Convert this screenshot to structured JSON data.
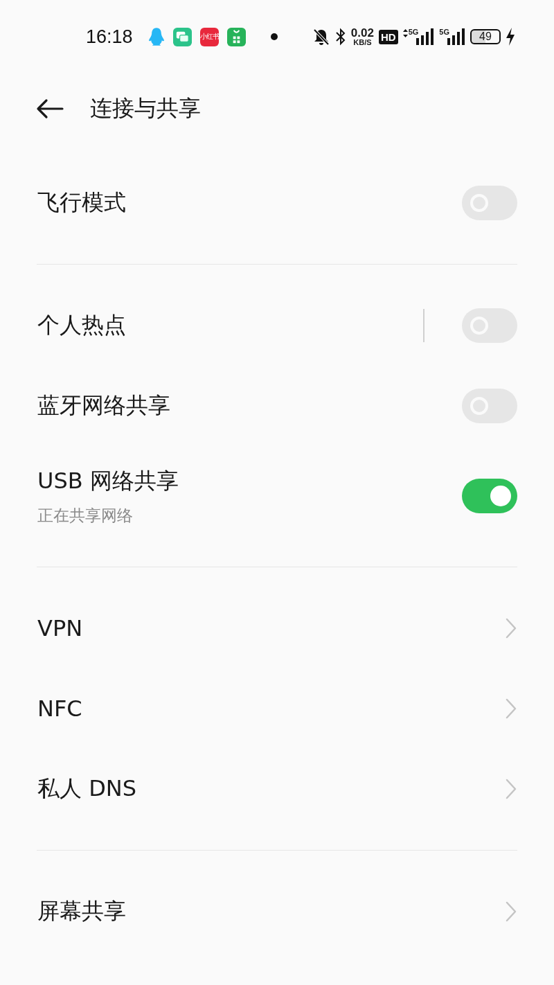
{
  "status_bar": {
    "time": "16:18",
    "apps": [
      {
        "kind": "penguin"
      },
      {
        "kind": "chat"
      },
      {
        "kind": "label",
        "label": "小红书"
      },
      {
        "kind": "bag"
      }
    ],
    "speed": "0.02",
    "speed_unit": "KB/S",
    "hd": "HD",
    "signals": [
      {
        "label": "5G",
        "arrows": true
      },
      {
        "label": "5G",
        "arrows": false
      }
    ],
    "battery": "49",
    "charging": true
  },
  "header": {
    "title": "连接与共享"
  },
  "groups": [
    {
      "rows": [
        {
          "kind": "toggle",
          "label": "飞行模式",
          "on": false
        }
      ]
    },
    {
      "rows": [
        {
          "kind": "toggle_split",
          "label": "个人热点",
          "on": false
        },
        {
          "kind": "toggle",
          "label": "蓝牙网络共享",
          "on": false
        },
        {
          "kind": "toggle",
          "label": "USB 网络共享",
          "subtitle": "正在共享网络",
          "on": true
        }
      ]
    },
    {
      "rows": [
        {
          "kind": "link",
          "label": "VPN"
        },
        {
          "kind": "link",
          "label": "NFC"
        },
        {
          "kind": "link",
          "label": "私人 DNS"
        }
      ]
    },
    {
      "rows": [
        {
          "kind": "link",
          "label": "屏幕共享"
        }
      ]
    }
  ]
}
